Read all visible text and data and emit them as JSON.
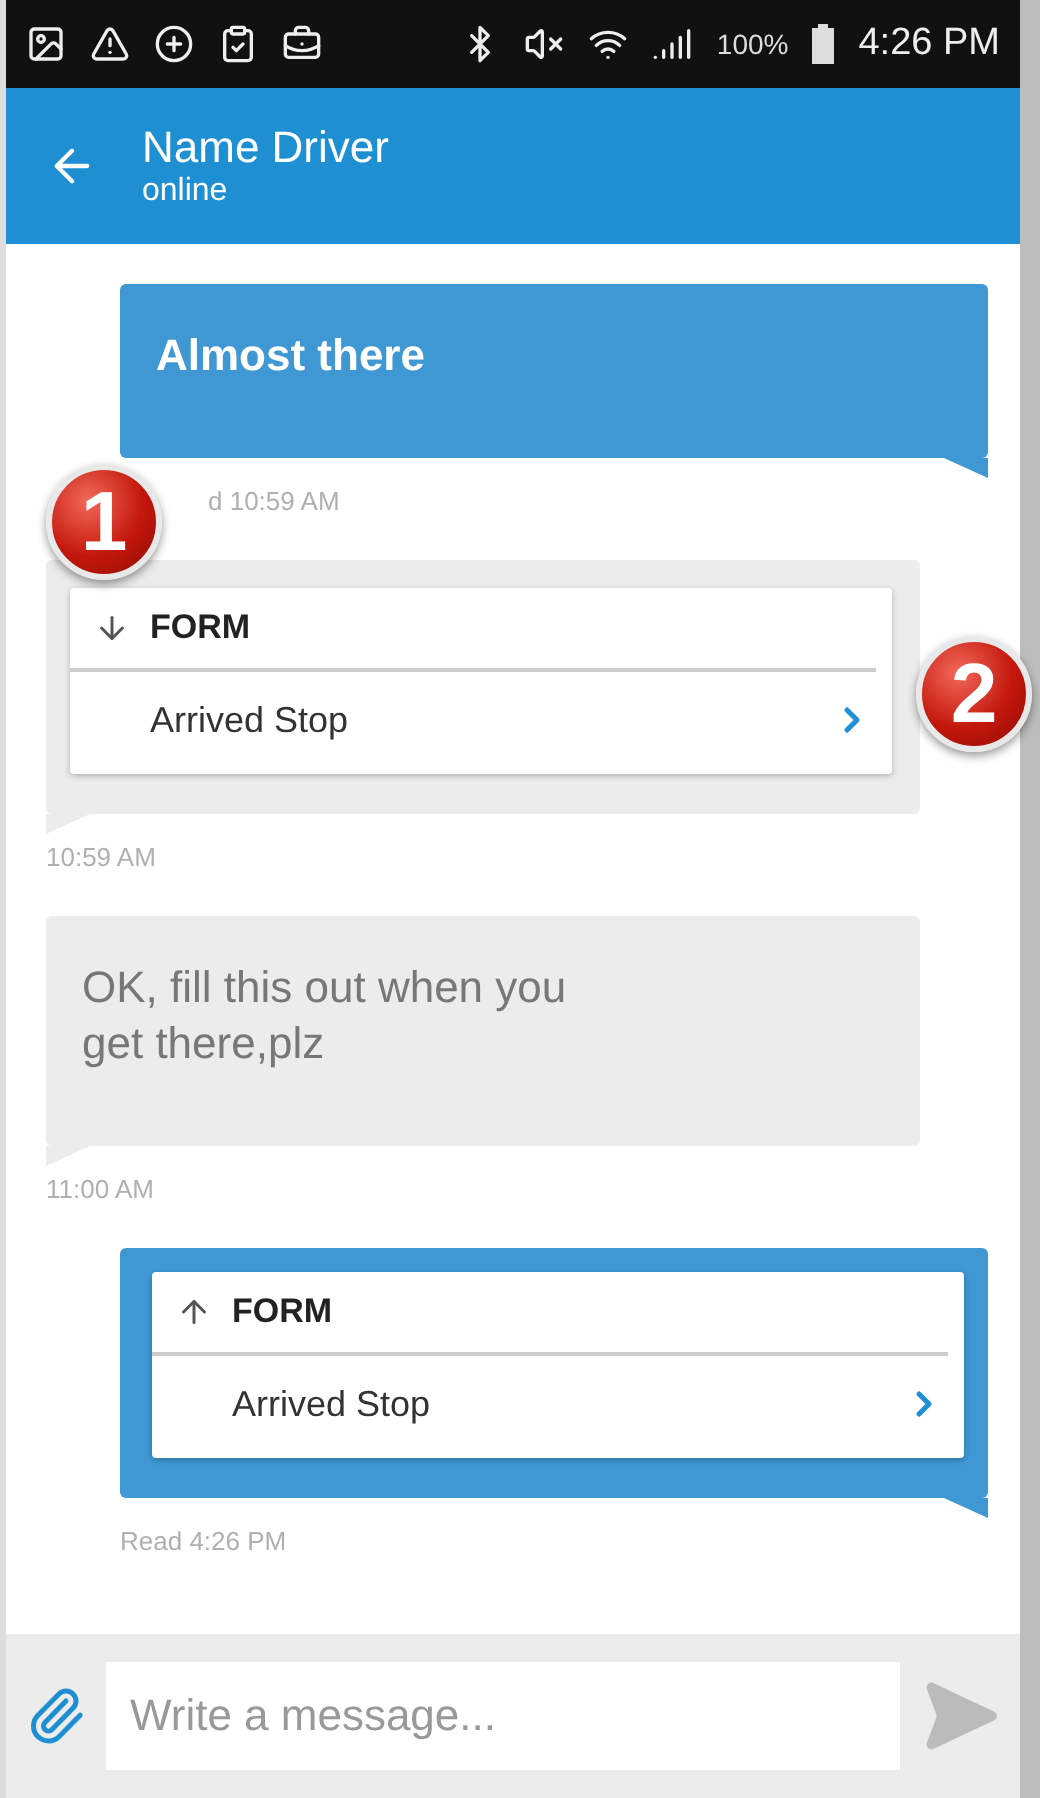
{
  "status_bar": {
    "battery": "100%",
    "time": "4:26 PM"
  },
  "header": {
    "title": "Name Driver",
    "subtitle": "online"
  },
  "messages": [
    {
      "kind": "text",
      "outgoing": true,
      "text": "Almost there",
      "meta": "d 10:59 AM",
      "meta_covered": true
    },
    {
      "kind": "form",
      "outgoing": false,
      "title": "FORM",
      "item": "Arrived Stop",
      "meta": "10:59 AM",
      "callouts": [
        "1",
        "2"
      ]
    },
    {
      "kind": "text",
      "outgoing": false,
      "text": "OK, fill this out when you get there,plz",
      "meta": "11:00 AM"
    },
    {
      "kind": "form",
      "outgoing": true,
      "title": "FORM",
      "item": "Arrived Stop",
      "meta": "Read 4:26 PM"
    }
  ],
  "composer": {
    "placeholder": "Write a message..."
  }
}
